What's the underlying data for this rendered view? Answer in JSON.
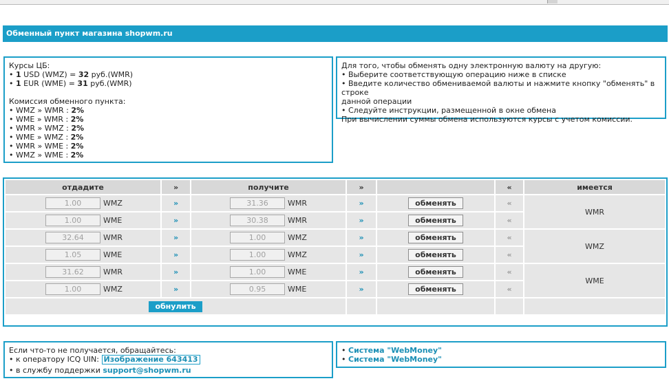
{
  "header": {
    "title": "Обменный пункт магазина shopwm.ru"
  },
  "rates": {
    "title": "Курсы ЦБ:",
    "items": [
      {
        "amount": "1",
        "cur": "USD (WMZ) =",
        "value": "32",
        "unit": "руб.(WMR)"
      },
      {
        "amount": "1",
        "cur": "EUR (WME) =",
        "value": "31",
        "unit": "руб.(WMR)"
      }
    ]
  },
  "commission": {
    "title": "Комиссия обменного пункта:",
    "items": [
      {
        "pair": "WMZ » WMR :",
        "value": "2%"
      },
      {
        "pair": "WME » WMR :",
        "value": "2%"
      },
      {
        "pair": "WMR » WMZ :",
        "value": "2%"
      },
      {
        "pair": "WME » WMZ :",
        "value": "2%"
      },
      {
        "pair": "WMR » WME :",
        "value": "2%"
      },
      {
        "pair": "WMZ » WME :",
        "value": "2%"
      }
    ]
  },
  "instructions": {
    "title": "Для того, чтобы обменять одну электронную валюту на другую:",
    "steps": [
      "Выберите соответствующую операцию ниже в списке",
      "Введите количество обмениваемой валюты и нажмите кнопку \"обменять\" в строке",
      "данной операции",
      "Следуйте инструкции, размещенной в окне обмена"
    ],
    "note": "При вычислении суммы обмена используются курсы с учетом комиссии."
  },
  "table": {
    "headers": {
      "give": "отдадите",
      "arrow": "»",
      "get": "получите",
      "back": "«",
      "have": "имеется"
    },
    "rows": [
      {
        "give": "1.00",
        "give_cur": "WMZ",
        "get": "31.36",
        "get_cur": "WMR",
        "btn": "обменять"
      },
      {
        "give": "1.00",
        "give_cur": "WME",
        "get": "30.38",
        "get_cur": "WMR",
        "btn": "обменять"
      },
      {
        "give": "32.64",
        "give_cur": "WMR",
        "get": "1.00",
        "get_cur": "WMZ",
        "btn": "обменять"
      },
      {
        "give": "1.05",
        "give_cur": "WME",
        "get": "1.00",
        "get_cur": "WMZ",
        "btn": "обменять"
      },
      {
        "give": "31.62",
        "give_cur": "WMR",
        "get": "1.00",
        "get_cur": "WME",
        "btn": "обменять"
      },
      {
        "give": "1.00",
        "give_cur": "WMZ",
        "get": "0.95",
        "get_cur": "WME",
        "btn": "обменять"
      }
    ],
    "have": [
      "WMR",
      "WMZ",
      "WME"
    ],
    "reset": "обнулить"
  },
  "contact": {
    "title": "Если что-то не получается, обращайтесь:",
    "icq_label": "к оператору ICQ UIN:",
    "icq_image": "Изображение",
    "icq_number": "643413",
    "support_label": "в службу поддержки",
    "support_email": "support@shopwm.ru"
  },
  "links": [
    "Система \"WebMoney\"",
    "Система \"WebMoney\""
  ]
}
